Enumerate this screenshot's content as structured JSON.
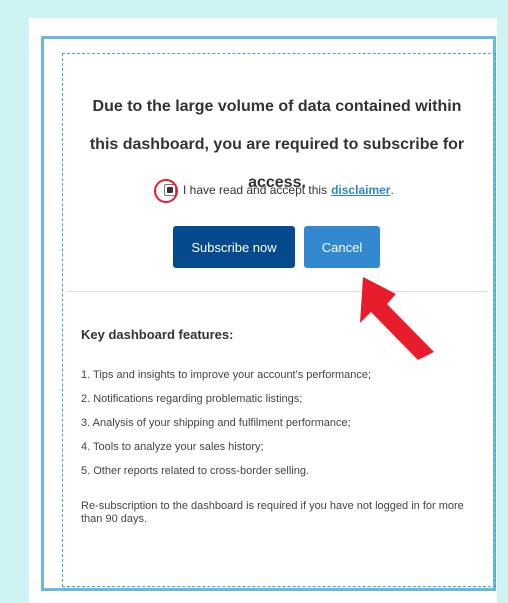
{
  "dialog": {
    "message": "Due to the large volume of data contained within this dashboard, you are required to subscribe for access.",
    "acceptance": {
      "checked": true,
      "text": "I have read and accept this",
      "link_label": "disclaimer",
      "suffix": "."
    },
    "actions": {
      "subscribe_label": "Subscribe now",
      "cancel_label": "Cancel"
    },
    "features": {
      "heading": "Key dashboard features:",
      "items": [
        "1. Tips and insights to improve your account's performance;",
        "2. Notifications regarding problematic listings;",
        "3. Analysis of your shipping and fulfilment performance;",
        "4. Tools to analyze your sales history;",
        "5. Other reports related to cross-border selling."
      ]
    },
    "resubscription_note": "Re-subscription to the dashboard is required if you have not logged in for more than 90 days."
  },
  "annotations": {
    "checkbox_highlight_color": "#e81d2b",
    "arrow_color": "#e81d2b",
    "arrow_target": "cancel-button"
  },
  "colors": {
    "background": "#cdf3f2",
    "dialog_border": "#6ab8de",
    "primary_button": "#064a8e",
    "secondary_button": "#3289cf",
    "link": "#2d86c8"
  }
}
